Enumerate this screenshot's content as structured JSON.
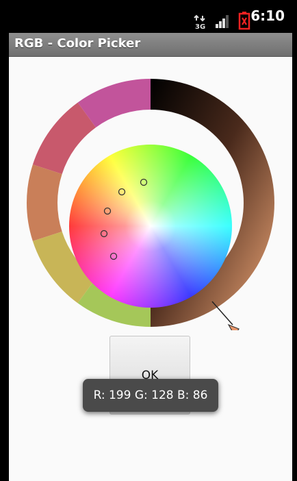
{
  "status_bar": {
    "network_label": "3G",
    "time": "6:10",
    "icons": [
      "data-transfer-3g-icon",
      "signal-strength-icon",
      "battery-low-icon"
    ]
  },
  "app": {
    "title": "RGB - Color Picker"
  },
  "picker": {
    "selected_rgb": [
      199,
      128,
      86
    ],
    "accent_color": "#C78056",
    "history_swatches": [
      "#C2549B",
      "#C8596C",
      "#C97F59",
      "#C8B557",
      "#A5C759"
    ],
    "history_markers": 5
  },
  "ok_button": {
    "label": "OK"
  },
  "toast": {
    "text": "R: 199 G: 128 B: 86"
  }
}
